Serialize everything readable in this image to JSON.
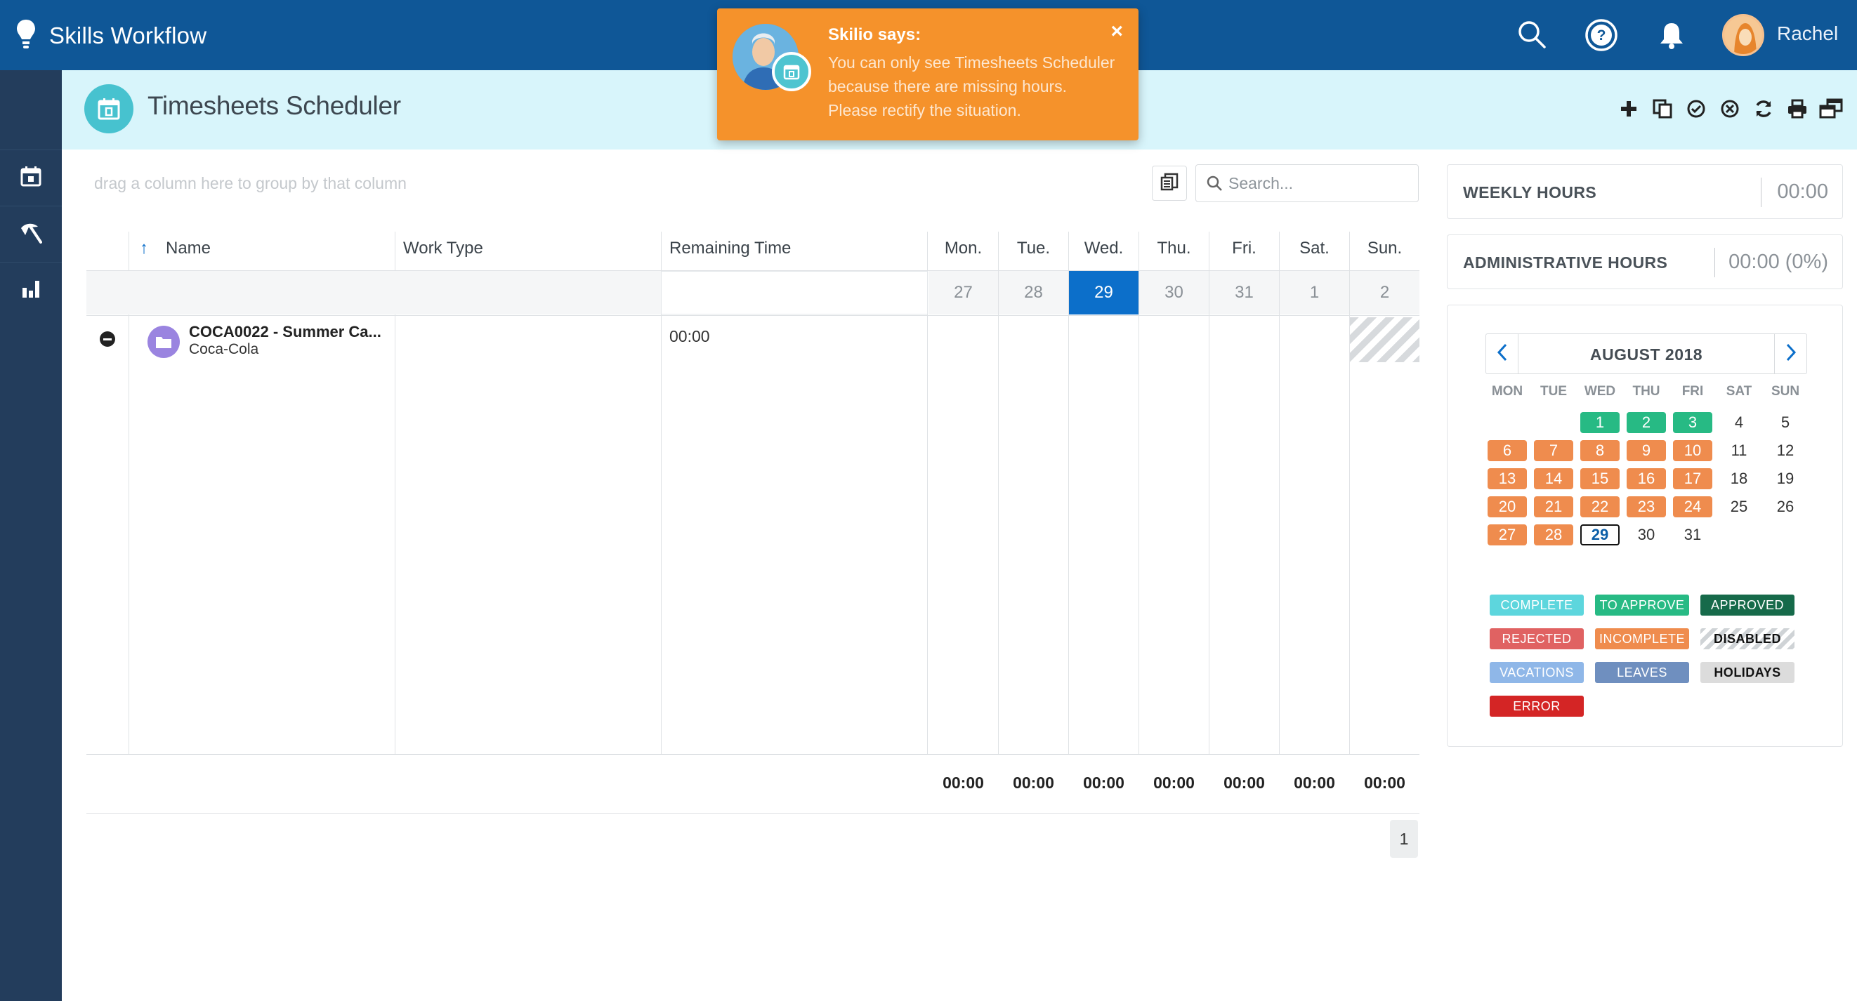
{
  "app": {
    "title": "Skills Workflow"
  },
  "user": {
    "name": "Rachel"
  },
  "page": {
    "title": "Timesheets Scheduler"
  },
  "toast": {
    "title": "Skilio says:",
    "message": "You can only see Timesheets Scheduler because there are missing hours. Please rectify the situation.",
    "close": "×"
  },
  "grid": {
    "group_hint": "drag a column here to group by that column",
    "search_placeholder": "Search...",
    "columns": {
      "name": "Name",
      "work_type": "Work Type",
      "remaining_time": "Remaining Time",
      "sort_arrow": "↑"
    },
    "days": [
      {
        "label": "Mon.",
        "num": "27"
      },
      {
        "label": "Tue.",
        "num": "28"
      },
      {
        "label": "Wed.",
        "num": "29"
      },
      {
        "label": "Thu.",
        "num": "30"
      },
      {
        "label": "Fri.",
        "num": "31"
      },
      {
        "label": "Sat.",
        "num": "1"
      },
      {
        "label": "Sun.",
        "num": "2"
      }
    ],
    "row": {
      "name": "COCA0022 - Summer Ca...",
      "client": "Coca-Cola",
      "remaining": "00:00"
    },
    "totals": [
      "00:00",
      "00:00",
      "00:00",
      "00:00",
      "00:00",
      "00:00",
      "00:00"
    ],
    "page": "1"
  },
  "stats": {
    "weekly_label": "WEEKLY HOURS",
    "weekly_value": "00:00",
    "admin_label": "ADMINISTRATIVE HOURS",
    "admin_value": "00:00 (0%)"
  },
  "calendar": {
    "month": "AUGUST 2018",
    "weekdays": [
      "MON",
      "TUE",
      "WED",
      "THU",
      "FRI",
      "SAT",
      "SUN"
    ],
    "weeks": [
      [
        "",
        "",
        "1",
        "2",
        "3",
        "4",
        "5"
      ],
      [
        "6",
        "7",
        "8",
        "9",
        "10",
        "11",
        "12"
      ],
      [
        "13",
        "14",
        "15",
        "16",
        "17",
        "18",
        "19"
      ],
      [
        "20",
        "21",
        "22",
        "23",
        "24",
        "25",
        "26"
      ],
      [
        "27",
        "28",
        "29",
        "30",
        "31",
        "",
        ""
      ]
    ]
  },
  "legend": {
    "complete": "COMPLETE",
    "to_approve": "TO APPROVE",
    "approved": "APPROVED",
    "rejected": "REJECTED",
    "incomplete": "INCOMPLETE",
    "disabled": "DISABLED",
    "vacations": "VACATIONS",
    "leaves": "LEAVES",
    "holidays": "HOLIDAYS",
    "error": "ERROR"
  },
  "colors": {
    "topbar": "#0f5797",
    "sidebar": "#233d5c",
    "header_bg": "#d8f5fb",
    "toast": "#f5922b",
    "today": "#0c6fca",
    "complete": "#5dd6dd",
    "to_approve": "#27ba84",
    "approved": "#166a4a",
    "rejected": "#e06262",
    "incomplete": "#ef8c4e",
    "vacations": "#8fb7e8",
    "leaves": "#6f8fbf",
    "holidays": "#dcdcdc",
    "error": "#d42525"
  }
}
